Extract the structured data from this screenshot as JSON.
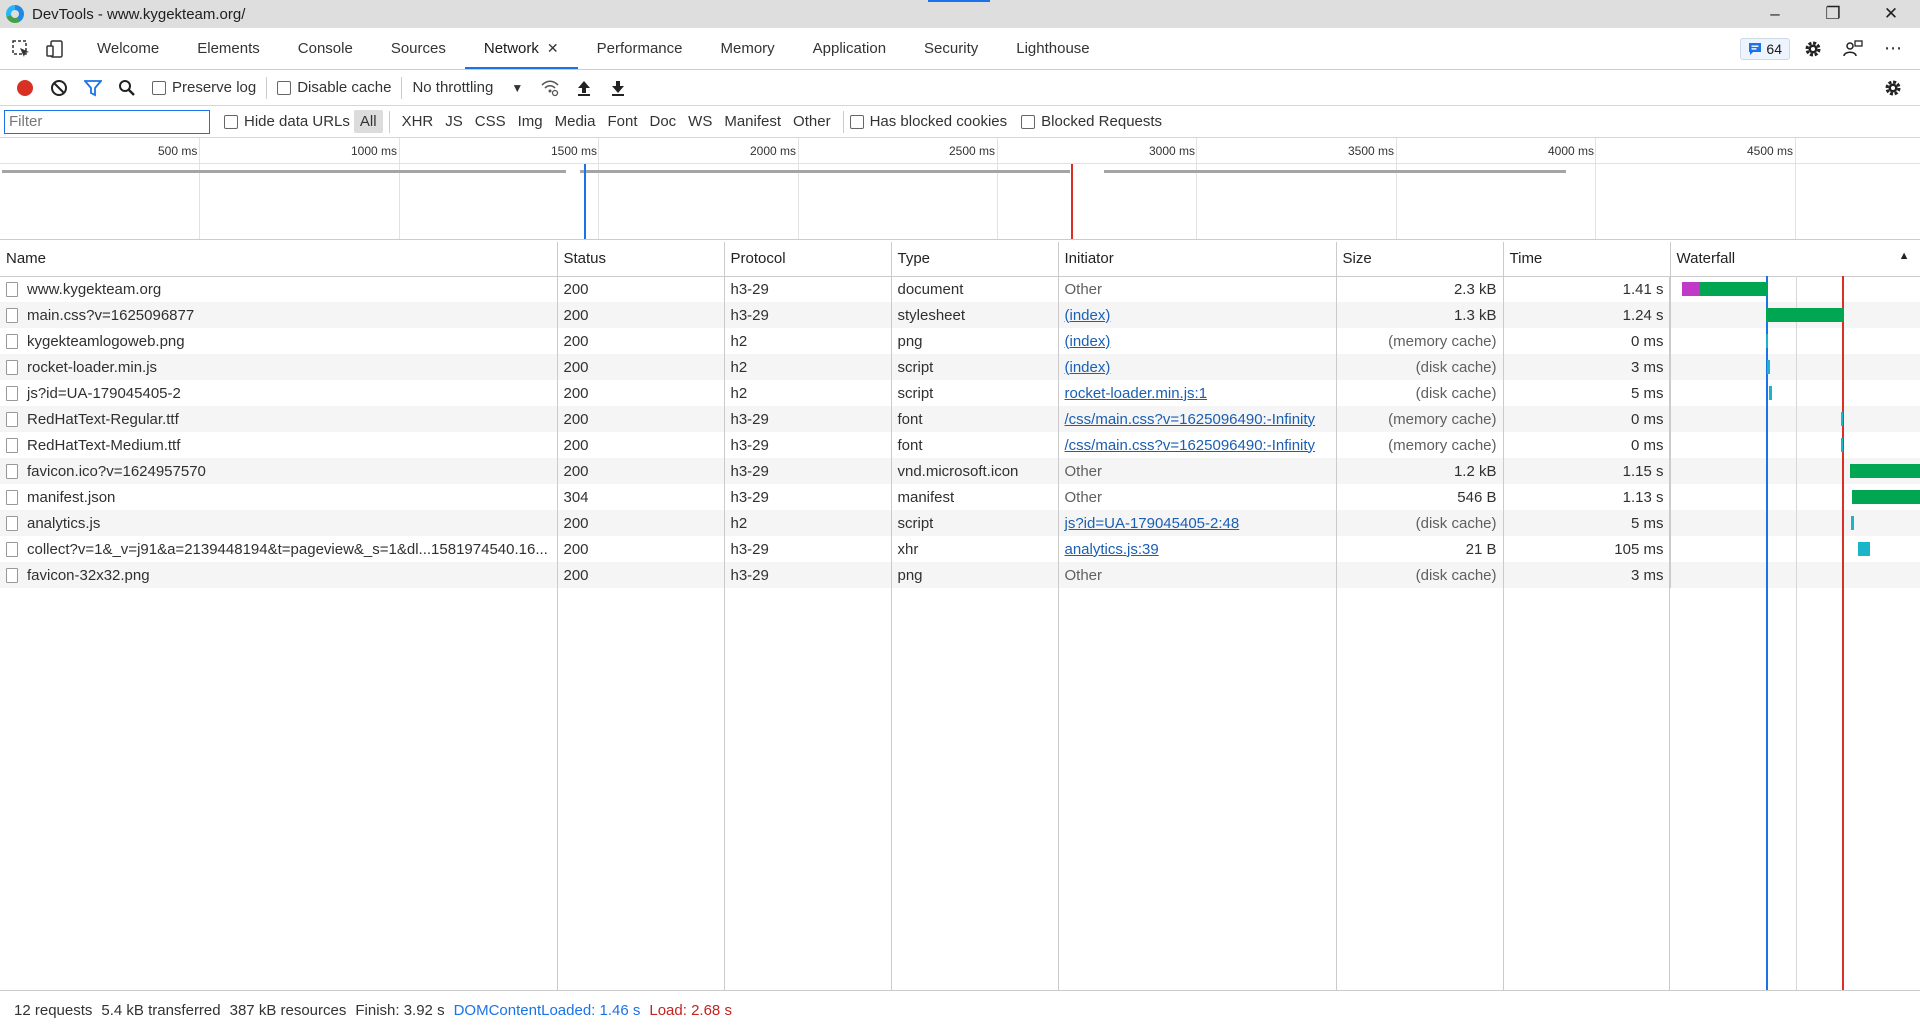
{
  "window": {
    "title": "DevTools - www.kygekteam.org/",
    "minimize": "–",
    "restore": "❐",
    "close": "✕"
  },
  "tabs": [
    {
      "label": "Welcome"
    },
    {
      "label": "Elements"
    },
    {
      "label": "Console"
    },
    {
      "label": "Sources"
    },
    {
      "label": "Network",
      "close": "✕"
    },
    {
      "label": "Performance"
    },
    {
      "label": "Memory"
    },
    {
      "label": "Application"
    },
    {
      "label": "Security"
    },
    {
      "label": "Lighthouse"
    }
  ],
  "issues_count": "64",
  "toolbar": {
    "preserve_log": "Preserve log",
    "disable_cache": "Disable cache",
    "throttling": "No throttling"
  },
  "filterbar": {
    "placeholder": "Filter",
    "hide_data_urls": "Hide data URLs",
    "types": [
      "All",
      "XHR",
      "JS",
      "CSS",
      "Img",
      "Media",
      "Font",
      "Doc",
      "WS",
      "Manifest",
      "Other"
    ],
    "has_blocked_cookies": "Has blocked cookies",
    "blocked_requests": "Blocked Requests"
  },
  "overview_ticks": [
    "500 ms",
    "1000 ms",
    "1500 ms",
    "2000 ms",
    "2500 ms",
    "3000 ms",
    "3500 ms",
    "4000 ms",
    "4500 ms"
  ],
  "columns": {
    "name": "Name",
    "status": "Status",
    "protocol": "Protocol",
    "type": "Type",
    "initiator": "Initiator",
    "size": "Size",
    "time": "Time",
    "waterfall": "Waterfall"
  },
  "requests": [
    {
      "name": "www.kygekteam.org",
      "status": "200",
      "protocol": "h3-29",
      "type": "document",
      "initiator": "Other",
      "initiator_link": false,
      "size": "2.3 kB",
      "time": "1.41 s"
    },
    {
      "name": "main.css?v=1625096877",
      "status": "200",
      "protocol": "h3-29",
      "type": "stylesheet",
      "initiator": "(index)",
      "initiator_link": true,
      "size": "1.3 kB",
      "time": "1.24 s"
    },
    {
      "name": "kygekteamlogoweb.png",
      "status": "200",
      "protocol": "h2",
      "type": "png",
      "initiator": "(index)",
      "initiator_link": true,
      "size": "(memory cache)",
      "time": "0 ms"
    },
    {
      "name": "rocket-loader.min.js",
      "status": "200",
      "protocol": "h2",
      "type": "script",
      "initiator": "(index)",
      "initiator_link": true,
      "size": "(disk cache)",
      "time": "3 ms"
    },
    {
      "name": "js?id=UA-179045405-2",
      "status": "200",
      "protocol": "h2",
      "type": "script",
      "initiator": "rocket-loader.min.js:1",
      "initiator_link": true,
      "size": "(disk cache)",
      "time": "5 ms"
    },
    {
      "name": "RedHatText-Regular.ttf",
      "status": "200",
      "protocol": "h3-29",
      "type": "font",
      "initiator": "/css/main.css?v=1625096490:-Infinity",
      "initiator_link": true,
      "size": "(memory cache)",
      "time": "0 ms"
    },
    {
      "name": "RedHatText-Medium.ttf",
      "status": "200",
      "protocol": "h3-29",
      "type": "font",
      "initiator": "/css/main.css?v=1625096490:-Infinity",
      "initiator_link": true,
      "size": "(memory cache)",
      "time": "0 ms"
    },
    {
      "name": "favicon.ico?v=1624957570",
      "status": "200",
      "protocol": "h3-29",
      "type": "vnd.microsoft.icon",
      "initiator": "Other",
      "initiator_link": false,
      "size": "1.2 kB",
      "time": "1.15 s"
    },
    {
      "name": "manifest.json",
      "status": "304",
      "protocol": "h3-29",
      "type": "manifest",
      "initiator": "Other",
      "initiator_link": false,
      "size": "546 B",
      "time": "1.13 s"
    },
    {
      "name": "analytics.js",
      "status": "200",
      "protocol": "h2",
      "type": "script",
      "initiator": "js?id=UA-179045405-2:48",
      "initiator_link": true,
      "size": "(disk cache)",
      "time": "5 ms"
    },
    {
      "name": "collect?v=1&_v=j91&a=2139448194&t=pageview&_s=1&dl...1581974540.16...",
      "status": "200",
      "protocol": "h3-29",
      "type": "xhr",
      "initiator": "analytics.js:39",
      "initiator_link": true,
      "size": "21 B",
      "time": "105 ms"
    },
    {
      "name": "favicon-32x32.png",
      "status": "200",
      "protocol": "h3-29",
      "type": "png",
      "initiator": "Other",
      "initiator_link": false,
      "size": "(disk cache)",
      "time": "3 ms"
    }
  ],
  "status": {
    "requests": "12 requests",
    "transferred": "5.4 kB transferred",
    "resources": "387 kB resources",
    "finish": "Finish: 3.92 s",
    "dom_content_loaded": "DOMContentLoaded: 1.46 s",
    "load": "Load: 2.68 s"
  },
  "colors": {
    "accent": "#1a73e8",
    "record": "#d93025",
    "dcl_line": "#1a73e8",
    "load_line": "#d93025",
    "waiting": "#00a651",
    "stalled": "#c039c7",
    "download": "#1bb5c9"
  }
}
